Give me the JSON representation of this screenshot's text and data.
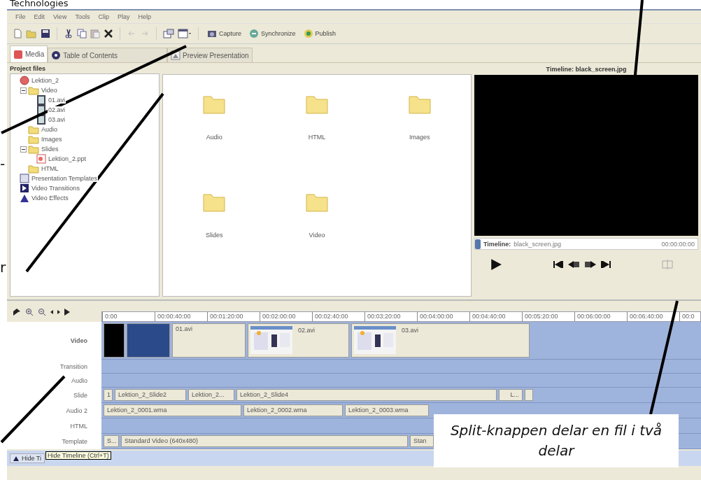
{
  "annotation_texts": {
    "top": "Technologies",
    "left": [
      "-",
      "r"
    ]
  },
  "menu": [
    "File",
    "Edit",
    "View",
    "Tools",
    "Clip",
    "Play",
    "Help"
  ],
  "toolbar_buttons": [
    "Capture",
    "Synchronize",
    "Publish"
  ],
  "tabs": [
    {
      "label": "Media",
      "selected": true
    },
    {
      "label": "Table of Contents",
      "selected": false
    },
    {
      "label": "Preview Presentation",
      "selected": false
    }
  ],
  "project_files": {
    "title": "Project files",
    "tree": [
      {
        "label": "Lektion_2",
        "kind": "project",
        "children": [
          {
            "label": "Video",
            "kind": "folder",
            "expanded": true,
            "children": [
              {
                "label": "01.avi",
                "kind": "video"
              },
              {
                "label": "02.avi",
                "kind": "video"
              },
              {
                "label": "03.avi",
                "kind": "video"
              }
            ]
          },
          {
            "label": "Audio",
            "kind": "folder"
          },
          {
            "label": "Images",
            "kind": "folder"
          },
          {
            "label": "Slides",
            "kind": "folder",
            "expanded": true,
            "children": [
              {
                "label": "Lektion_2.ppt",
                "kind": "slides"
              }
            ]
          },
          {
            "label": "HTML",
            "kind": "folder"
          }
        ]
      },
      {
        "label": "Presentation Templates",
        "kind": "template"
      },
      {
        "label": "Video Transitions",
        "kind": "transition"
      },
      {
        "label": "Video Effects",
        "kind": "effect"
      }
    ]
  },
  "folders": [
    "Audio",
    "HTML",
    "Images",
    "Slides",
    "Video"
  ],
  "preview": {
    "title": "Timeline: black_screen.jpg",
    "clip_label": "Timeline:",
    "clip_name": "black_screen.jpg",
    "time": "00:00:00:00"
  },
  "timeline": {
    "ruler": [
      "0:00",
      "00:00:40:00",
      "00:01:20:00",
      "00:02:00:00",
      "00:02:40:00",
      "00:03:20:00",
      "00:04:00:00",
      "00:04:40:00",
      "00:05:20:00",
      "00:06:00:00",
      "00:06:40:00",
      "00:0"
    ],
    "tracks": [
      {
        "name": "Video",
        "clips": [
          {
            "kind": "black",
            "selected": false
          },
          {
            "kind": "blank",
            "selected": true
          },
          {
            "kind": "plain",
            "label": "01.avi",
            "selected": false
          },
          {
            "kind": "thumb",
            "label": "02.avi",
            "selected": false
          },
          {
            "kind": "thumb",
            "label": "03.avi",
            "selected": false
          }
        ]
      },
      {
        "name": "Transition"
      },
      {
        "name": "Audio"
      },
      {
        "name": "Slide",
        "clips": [
          {
            "kind": "plain",
            "label": "1",
            "selected": false
          },
          {
            "kind": "plain",
            "label": "Lektion_2_Slide2",
            "selected": false
          },
          {
            "kind": "plain",
            "label": "Lektion_2...",
            "selected": false
          },
          {
            "kind": "plain",
            "label": "Lektion_2_Slide4",
            "selected": false
          },
          {
            "kind": "plain",
            "label": "L...",
            "selected": false
          },
          {
            "kind": "blank",
            "selected": false
          }
        ]
      },
      {
        "name": "Audio 2",
        "clips": [
          {
            "kind": "plain",
            "label": "Lektion_2_0001.wma",
            "selected": false
          },
          {
            "kind": "plain",
            "label": "Lektion_2_0002.wma",
            "selected": false
          },
          {
            "kind": "plain",
            "label": "Lektion_2_0003.wma",
            "selected": false
          }
        ]
      },
      {
        "name": "HTML"
      },
      {
        "name": "Template",
        "clips": [
          {
            "kind": "plain",
            "label": "S...",
            "selected": false
          },
          {
            "kind": "plain",
            "label": "Standard Video (640x480)",
            "selected": false
          },
          {
            "kind": "plain",
            "label": "Stan",
            "selected": false
          }
        ]
      }
    ]
  },
  "hide_button": "Hide Ti",
  "tooltip": "Hide Timeline (Ctrl+T)",
  "callout": "Split-knappen delar en fil i två delar"
}
